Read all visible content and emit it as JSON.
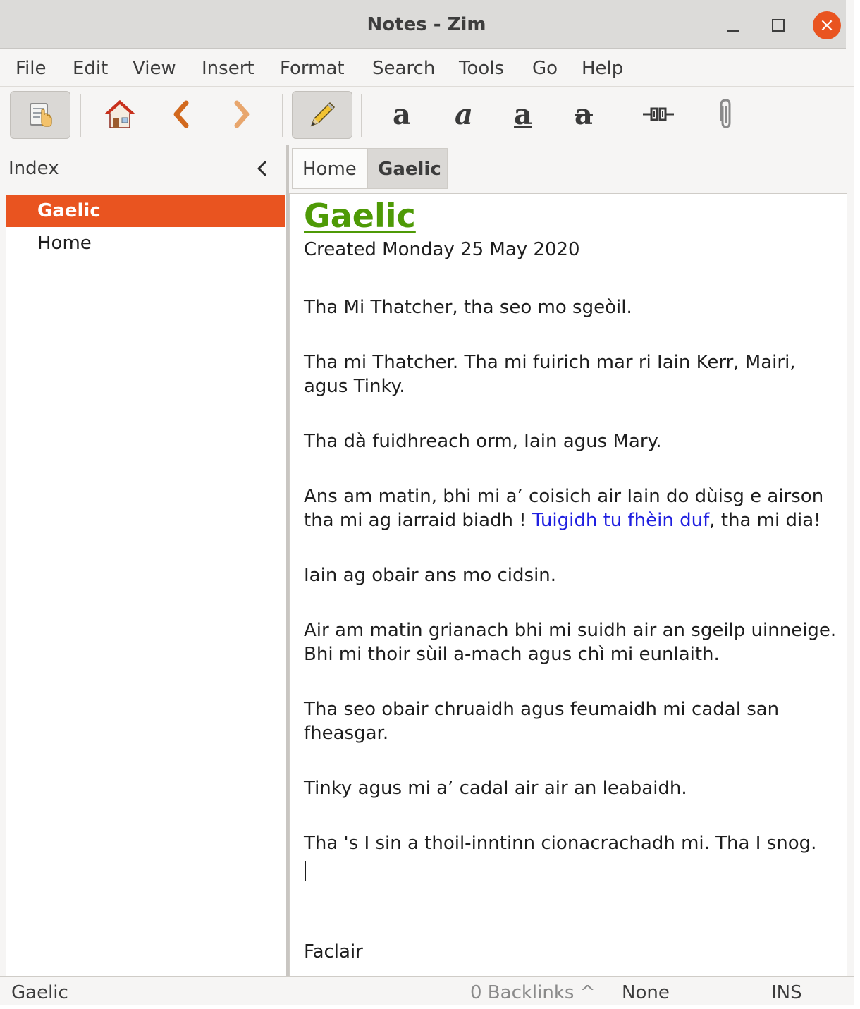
{
  "window": {
    "title": "Notes - Zim",
    "close_glyph": "×"
  },
  "menu": [
    "File",
    "Edit",
    "View",
    "Insert",
    "Format",
    "Search",
    "Tools",
    "Go",
    "Help"
  ],
  "toolbar": {
    "icons": [
      "index-toggle-icon",
      "home-icon",
      "back-icon",
      "forward-icon",
      "edit-pencil-icon",
      "bold-icon",
      "italic-icon",
      "underline-icon",
      "strikethrough-icon",
      "link-icon",
      "attach-icon"
    ],
    "glyphs": {
      "bold": "a",
      "italic": "a",
      "underline": "a",
      "strike": "a"
    }
  },
  "index": {
    "label": "Index",
    "items": [
      {
        "label": "Gaelic",
        "selected": true
      },
      {
        "label": "Home",
        "selected": false
      }
    ]
  },
  "pathbar": {
    "crumbs": [
      "Home",
      "Gaelic"
    ]
  },
  "page": {
    "heading": "Gaelic",
    "created": "Created Monday 25 May 2020",
    "paragraphs": [
      "Tha Mi Thatcher, tha seo mo sgeòil.",
      "Tha mi Thatcher. Tha mi fuirich mar ri Iain Kerr, Mairi, agus Tinky.",
      "Tha dà fuidhreach orm, Iain agus Mary.",
      "Iain ag obair ans mo cidsin.",
      "Air am matin grianach bhi mi suidh air an sgeilp uinneige. Bhi mi thoir sùil a-mach agus chì mi eunlaith.",
      "Tha seo obair chruaidh agus feumaidh mi cadal san fheasgar.",
      "Tinky agus mi a’ cadal air air an leabaidh.",
      "Tha 's I sin a thoil-inntinn cionacrachadh mi. Tha I snog."
    ],
    "p4": {
      "before": "Ans am matin, bhi mi a’ coisich air Iain do dùisg e airson tha mi ag iarraid biadh ! ",
      "link": "Tuigidh tu fhèin duf",
      "after": ", tha mi dia!"
    },
    "footer_word": "Faclair"
  },
  "status": {
    "page": "Gaelic",
    "backlinks": "0 Backlinks ^",
    "style": "None",
    "mode": "INS"
  },
  "colors": {
    "accent": "#e95420",
    "heading": "#4e9a06",
    "link": "#1f1fe0"
  }
}
